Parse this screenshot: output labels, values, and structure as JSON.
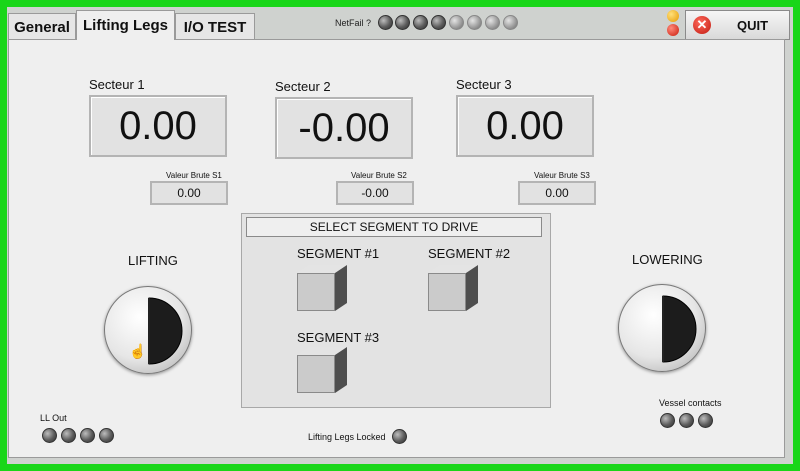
{
  "tabs": [
    "General",
    "Lifting Legs",
    "I/O TEST"
  ],
  "header": {
    "netfail_label": "NetFail ?",
    "netfail_led_count": 8
  },
  "quit": {
    "label": "QUIT"
  },
  "sectors": [
    {
      "title": "Secteur 1",
      "value": "0.00",
      "raw_label": "Valeur Brute S1",
      "raw_value": "0.00"
    },
    {
      "title": "Secteur 2",
      "value": "-0.00",
      "raw_label": "Valeur Brute S2",
      "raw_value": "-0.00"
    },
    {
      "title": "Secteur 3",
      "value": "0.00",
      "raw_label": "Valeur Brute S3",
      "raw_value": "0.00"
    }
  ],
  "segments": {
    "title": "SELECT SEGMENT TO DRIVE",
    "items": [
      "SEGMENT #1",
      "SEGMENT #2",
      "SEGMENT #3"
    ]
  },
  "lifting": {
    "label": "LIFTING"
  },
  "lowering": {
    "label": "LOWERING"
  },
  "ll_out": {
    "label": "LL Out"
  },
  "locked": {
    "label": "Lifting Legs Locked"
  },
  "vessel": {
    "label": "Vessel contacts"
  },
  "colors": {
    "frame": "#19d619",
    "status_yellow": "#f0b000",
    "status_red": "#e02010"
  }
}
